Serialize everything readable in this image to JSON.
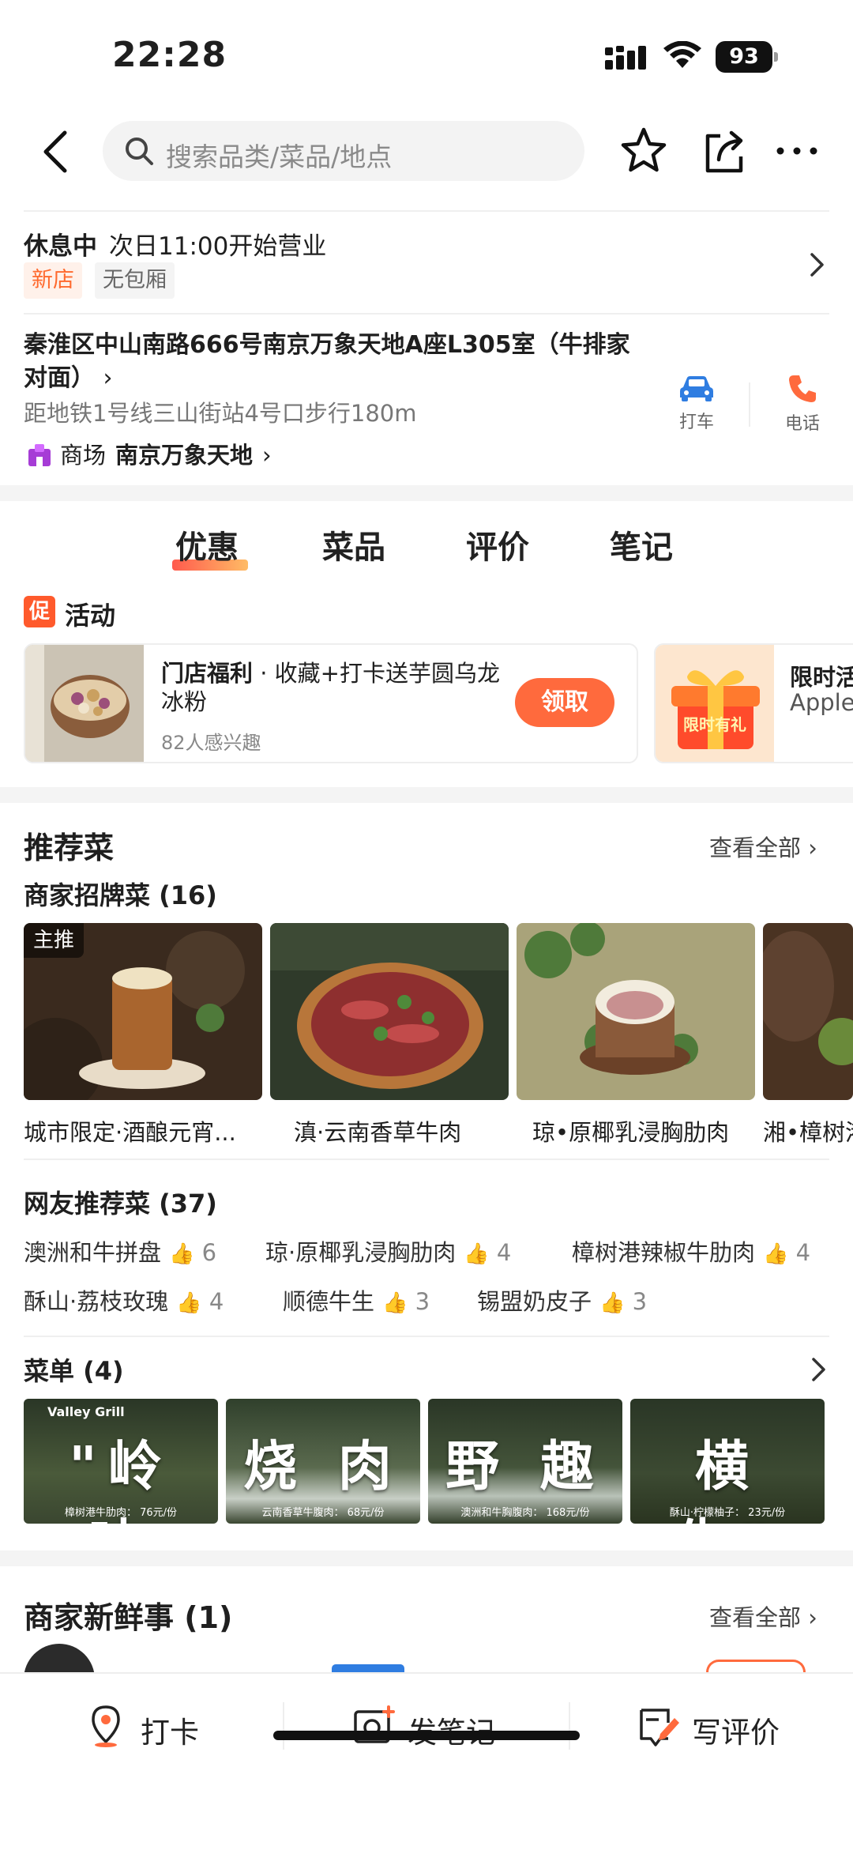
{
  "status_bar": {
    "time": "22:28",
    "battery": "93"
  },
  "search": {
    "placeholder": "搜索品类/菜品/地点"
  },
  "shop_status": {
    "state": "休息中",
    "next_open": "次日11:00开始营业",
    "tags": [
      "新店",
      "无包厢"
    ]
  },
  "address": {
    "text": "秦淮区中山南路666号南京万象天地A座L305室（牛排家对面）",
    "distance": "距地铁1号线三山街站4号口步行180m",
    "mall_label": "商场",
    "mall_name": "南京万象天地",
    "taxi_label": "打车",
    "phone_label": "电话"
  },
  "tabs": [
    "优惠",
    "菜品",
    "评价",
    "笔记"
  ],
  "promo": {
    "badge": "促",
    "title": "活动",
    "card1": {
      "title": "门店福利",
      "desc": "收藏+打卡送芋圆乌龙冰粉",
      "count": "82人感兴趣",
      "button": "领取"
    },
    "card2": {
      "title": "限时活",
      "subtitle": "Apple",
      "image_text": "限时有礼"
    }
  },
  "recommend": {
    "title": "推荐菜",
    "see_all": "查看全部",
    "signature_title": "商家招牌菜 (16)",
    "main_tag": "主推",
    "dishes": [
      "城市限定·酒酿元宵...",
      "滇·云南香草牛肉",
      "琼•原椰乳浸胸肋肉",
      "湘•樟树港"
    ],
    "netizen_title": "网友推荐菜 (37)",
    "netizen_items": [
      {
        "name": "澳洲和牛拼盘",
        "count": "6"
      },
      {
        "name": "琼·原椰乳浸胸肋肉",
        "count": "4"
      },
      {
        "name": "樟树港辣椒牛肋肉",
        "count": "4"
      },
      {
        "name": "酥山·荔枝玫瑰",
        "count": "4"
      },
      {
        "name": "顺德牛生",
        "count": "3"
      },
      {
        "name": "锡盟奶皮子",
        "count": "3"
      }
    ]
  },
  "menu": {
    "title": "菜单 (4)",
    "brand": "Valley Grill",
    "items": [
      {
        "big": "\"岭 味",
        "price": "樟树港牛肋肉： 76元/份"
      },
      {
        "big": "烧 肉",
        "price": "云南香草牛腹肉： 68元/份"
      },
      {
        "big": "野 趣",
        "price": "澳洲和牛胸腹肉： 168元/份"
      },
      {
        "big": "横 生\"",
        "price": "酥山·柠檬柚子： 23元/份"
      }
    ]
  },
  "news": {
    "title": "商家新鲜事 (1)",
    "see_all": "查看全部"
  },
  "bottom_bar": {
    "checkin": "打卡",
    "note": "发笔记",
    "review": "写评价"
  },
  "colors": {
    "accent": "#ff6a3d",
    "tab_underline": "#ff3d2e",
    "tag_new": "#ff6a2e"
  }
}
